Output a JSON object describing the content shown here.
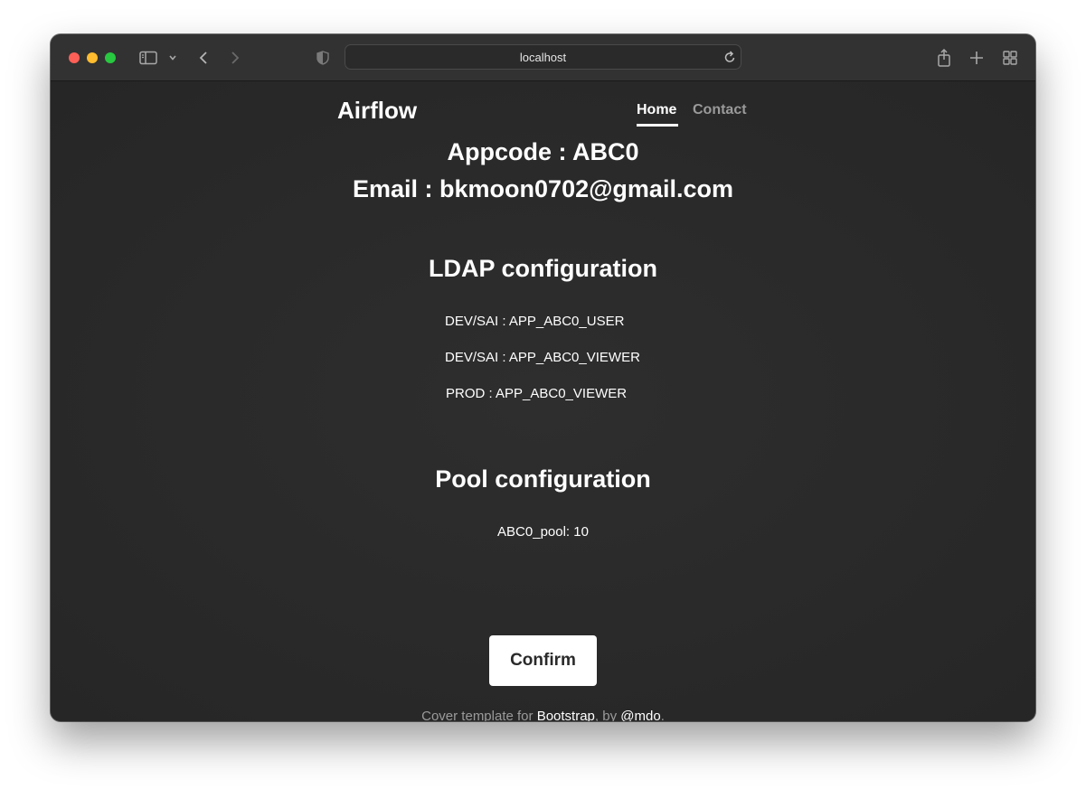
{
  "browser": {
    "address": "localhost"
  },
  "nav": {
    "brand": "Airflow",
    "home": "Home",
    "contact": "Contact"
  },
  "main": {
    "appcode_line": "Appcode : ABC0",
    "email_line": "Email : bkmoon0702@gmail.com",
    "ldap": {
      "title": "LDAP configuration",
      "items": [
        "DEV/SAI : APP_ABC0_USER",
        "DEV/SAI : APP_ABC0_VIEWER",
        "PROD : APP_ABC0_VIEWER"
      ]
    },
    "pool": {
      "title": "Pool configuration",
      "items": [
        "ABC0_pool: 10"
      ]
    },
    "confirm_label": "Confirm"
  },
  "footer": {
    "prefix": "Cover template for ",
    "link1": "Bootstrap",
    "middle": ", by ",
    "link2": "@mdo",
    "suffix": "."
  },
  "icons": [
    "sidebar-icon",
    "chevron-down-icon",
    "back-icon",
    "forward-icon",
    "shield-icon",
    "reload-icon",
    "share-icon",
    "new-tab-icon",
    "tab-overview-icon"
  ]
}
